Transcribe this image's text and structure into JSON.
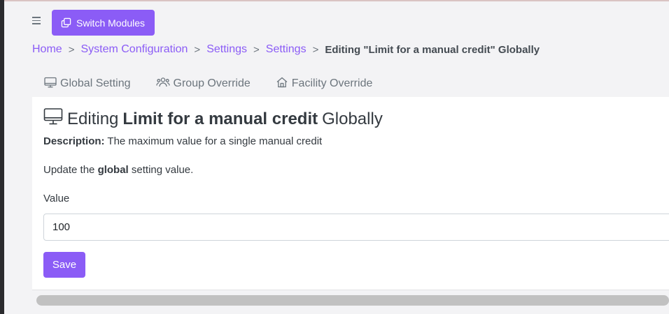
{
  "header": {
    "menu_icon": "hamburger-icon",
    "switch_modules_label": "Switch Modules",
    "switch_modules_icon": "copy-icon"
  },
  "breadcrumb": {
    "items": [
      "Home",
      "System Configuration",
      "Settings",
      "Settings"
    ],
    "separator": ">",
    "current": "Editing \"Limit for a manual credit\" Globally"
  },
  "tabs": [
    {
      "label": "Global Setting",
      "icon": "monitor-icon"
    },
    {
      "label": "Group Override",
      "icon": "users-icon"
    },
    {
      "label": "Facility Override",
      "icon": "home-icon"
    }
  ],
  "panel": {
    "title_prefix": "Editing",
    "title_setting": "Limit for a manual credit",
    "title_suffix": "Globally",
    "description_label": "Description:",
    "description_text": "The maximum value for a single manual credit",
    "update_prefix": "Update the",
    "update_scope": "global",
    "update_suffix": "setting value.",
    "value_label": "Value",
    "value": "100",
    "save_label": "Save"
  },
  "colors": {
    "accent": "#8b5cf6",
    "text": "#343a40",
    "muted": "#6c757d"
  }
}
